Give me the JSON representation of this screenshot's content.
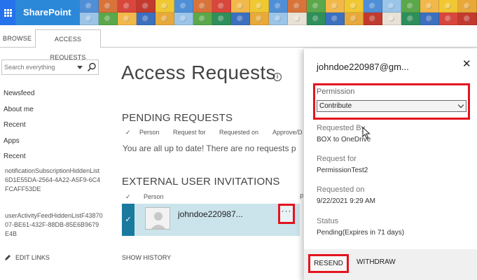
{
  "suite": {
    "app_name": "SharePoint",
    "accent": "#2672ec",
    "brand_bg": "#2b88d8"
  },
  "ribbon": {
    "tabs": [
      "BROWSE",
      "ACCESS REQUESTS"
    ],
    "active_tab": "ACCESS REQUESTS"
  },
  "search": {
    "placeholder": "Search everything"
  },
  "nav": {
    "items": [
      "Newsfeed",
      "About me",
      "Recent",
      "Apps",
      "Recent"
    ],
    "recent_items": [
      "notificationSubscriptionHiddenList6D1E55DA-2564-4A22-A5F9-6C4FCAFF53DE",
      "userActivityFeedHiddenListF4387007-BE61-432F-88DB-85E6B9679E4B"
    ],
    "edit_links": "EDIT LINKS"
  },
  "main": {
    "title": "Access Requests",
    "pending": {
      "heading": "PENDING REQUESTS",
      "columns": [
        "Person",
        "Request for",
        "Requested on",
        "Approve/D"
      ],
      "empty_message": "You are all up to date! There are no requests p"
    },
    "external": {
      "heading": "EXTERNAL USER INVITATIONS",
      "columns": [
        "Person",
        "P"
      ],
      "rows": [
        {
          "person": "johndoe220987..."
        }
      ]
    },
    "show_history": "SHOW HISTORY",
    "ellipsis_label": "···"
  },
  "panel": {
    "title": "johndoe220987@gm...",
    "permission_label": "Permission",
    "permission_value": "Contribute",
    "requested_by_label": "Requested By",
    "requested_by_value": "BOX to OneDrive",
    "request_for_label": "Request for",
    "request_for_value": "PermissionTest2",
    "requested_on_label": "Requested on",
    "requested_on_value": "9/22/2021 9:29 AM",
    "status_label": "Status",
    "status_value": "Pending(Expires in 71 days)",
    "resend_label": "RESEND",
    "withdraw_label": "WITHDRAW"
  },
  "colors": {
    "highlight": "#e3141f",
    "selected_row": "#cbe4ec",
    "selected_check": "#1a7a9e"
  }
}
